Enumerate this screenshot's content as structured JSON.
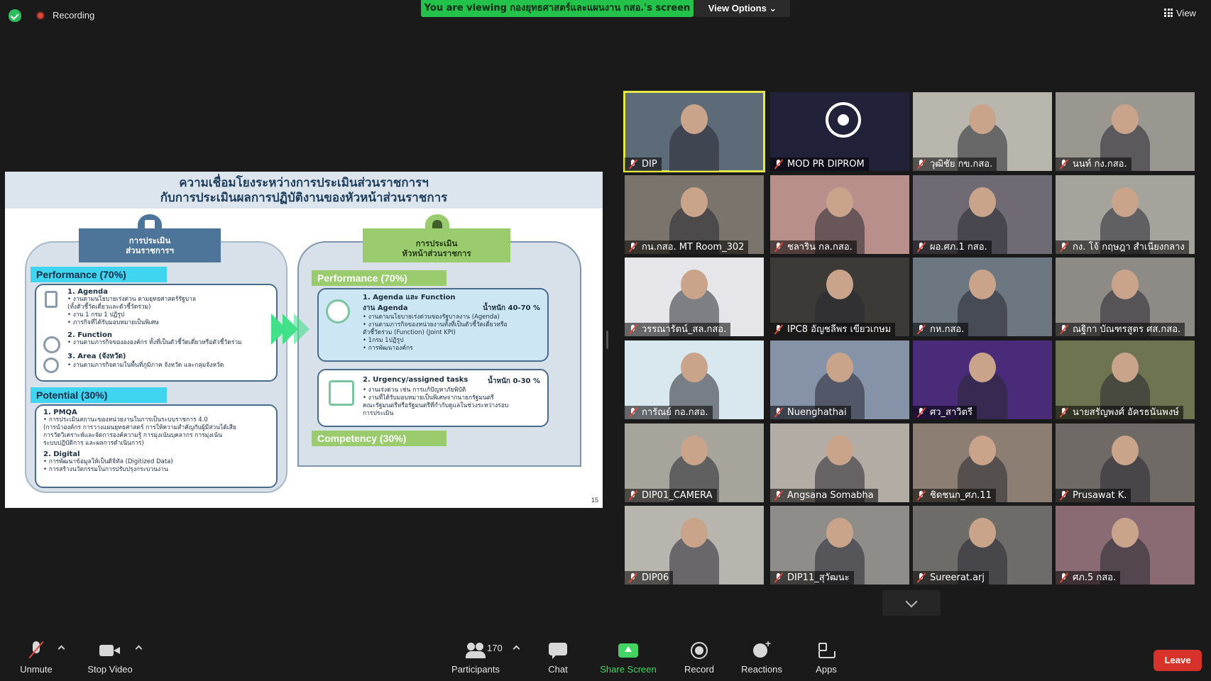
{
  "topbar": {
    "recording_label": "Recording",
    "viewing_banner": "You are viewing กองยุทธศาสตร์และแผนงาน กสอ.'s screen",
    "view_options_label": "View Options ⌄",
    "view_label": "View"
  },
  "slide": {
    "title_line1": "ความเชื่อมโยงระหว่างการประเมินส่วนราชการฯ",
    "title_line2": "กับการประเมินผลการปฏิบัติงานของหัวหน้าส่วนราชการ",
    "left_head_line1": "การประเมิน",
    "left_head_line2": "ส่วนราชการฯ",
    "right_head_line1": "การประเมิน",
    "right_head_line2": "หัวหน้าส่วนราชการ",
    "left_performance": "Performance (70%)",
    "left_potential": "Potential (30%)",
    "right_performance": "Performance (70%)",
    "right_competency": "Competency (30%)",
    "agenda_h": "1. Agenda",
    "agenda_t1": "• งานตามนโยบายเร่งด่วน ตามยุทธศาสตร์รัฐบาล",
    "agenda_t2": "(ทั้งตัวชี้วัดเดี่ยวและตัวชี้วัดร่วม)",
    "agenda_t3": "• งาน 1 กรม 1 ปฏิรูป",
    "agenda_t4": "• ภารกิจที่ได้รับมอบหมายเป็นพิเศษ",
    "function_h": "2. Function",
    "function_t1": "• งานตามภารกิจของององค์กร ทั้งที่เป็นตัวชี้วัดเดี่ยวหรือตัวชี้วัดร่วม",
    "area_h": "3. Area (จังหวัด)",
    "area_t1": "• งานตามภารกิจตามในพื้นที่ภูมิภาค จังหวัด และกลุ่มจังหวัด",
    "pmqa_h": "1. PMQA",
    "pmqa_t1": "• การประเมินสถานะของหน่วยงานในการเป็นระบบราชการ 4.0",
    "pmqa_t2": "(การนำองค์กร การวางแผนยุทธศาสตร์ การให้ความสำคัญกับผู้มีส่วนได้เสีย",
    "pmqa_t3": "การวัดวิเคราะห์และจัดการองค์ความรู้ การมุ่งเน้นบุคลากร การมุ่งเน้น",
    "pmqa_t4": "ระบบปฏิบัติการ และผลการดำเนินการ)",
    "digital_h": "2. Digital",
    "digital_t1": "• การพัฒนาข้อมูลให้เป็นดิจิทัล (Digitized Data)",
    "digital_t2": "• การสร้างนวัตกรรมในการปรับปรุงกระบวนงาน",
    "ra_h": "1. Agenda และ Function",
    "ra_sub": "งาน Agenda",
    "ra_weight": "น้ำหนัก 40-70 %",
    "ra_t1": "• งานตามนโยบายเร่งด่วนของรัฐบาลงาน (Agenda)",
    "ra_t2": "• งานตามภารกิจของหน่วยงานทั้งที่เป็นตัวชี้วัดเดี่ยวหรือ",
    "ra_t3": "ตัวชี้วัดร่วม (Function) (Joint KPI)",
    "ra_t4": "• 1กรม 1ปฏิรูป",
    "ra_t5": "• การพัฒนาองค์กร",
    "rb_h": "2. Urgency/assigned tasks",
    "rb_weight": "น้ำหนัก 0-30 %",
    "rb_t1": "• งานเร่งด่วน เช่น การแก้ปัญหาภัยพิบัติ",
    "rb_t2": "• งานที่ได้รับมอบหมายเป็นพิเศษจากนายกรัฐมนตรี",
    "rb_t3": "คณะรัฐมนตรีหรือรัฐมนตรีที่กำกับดูแลในช่วงระหว่างรอบ",
    "rb_t4": "การประเมิน",
    "page_number": "15"
  },
  "participants_tiles": [
    {
      "name": "DIP",
      "bg": "#5d6b78",
      "active": true
    },
    {
      "name": "MOD PR DIPROM",
      "bg": "#22213a",
      "active": false
    },
    {
      "name": "วุฒิชัย กข.กสอ.",
      "bg": "#b9b6ae",
      "active": false
    },
    {
      "name": "นนท์ กง.กสอ.",
      "bg": "#9a9690",
      "active": false
    },
    {
      "name": "กน.กสอ. MT Room_302",
      "bg": "#7a746c",
      "active": false
    },
    {
      "name": "ชลาริน กล.กสอ.",
      "bg": "#b88f8a",
      "active": false
    },
    {
      "name": "ผอ.ศภ.1 กสอ.",
      "bg": "#6f6a74",
      "active": false
    },
    {
      "name": "กง. โจ้ กฤษฎา สำเนียงกลาง",
      "bg": "#a4a39c",
      "active": false
    },
    {
      "name": "วรรณารัตน์_สล.กสอ.",
      "bg": "#e6e6ea",
      "active": false
    },
    {
      "name": "IPC8 อัญชลีพร เขียวเกษม",
      "bg": "#3c3a36",
      "active": false
    },
    {
      "name": "กห.กสอ.",
      "bg": "#6c7782",
      "active": false
    },
    {
      "name": "ณฐิกา บัณฑรสูตร ศส.กสอ.",
      "bg": "#8e8a86",
      "active": false
    },
    {
      "name": "การัณย์ กอ.กสอ.",
      "bg": "#d9e7ee",
      "active": false
    },
    {
      "name": "Nuenghathai",
      "bg": "#8592a8",
      "active": false
    },
    {
      "name": "ศว_สาวิตรี",
      "bg": "#4a2b7a",
      "active": false
    },
    {
      "name": "นายสรัญพงศ์ อัครธนันพงษ์",
      "bg": "#6f7450",
      "active": false
    },
    {
      "name": "DIP01_CAMERA",
      "bg": "#a7a49c",
      "active": false
    },
    {
      "name": "Angsana Somabha",
      "bg": "#b3aca4",
      "active": false
    },
    {
      "name": "ชิดชนก_ศภ.11",
      "bg": "#8c7e72",
      "active": false
    },
    {
      "name": "Prusawat K.",
      "bg": "#6f6a66",
      "active": false
    },
    {
      "name": "DIP06",
      "bg": "#b8b4ae",
      "active": false
    },
    {
      "name": "DIP11_สุวัฒนะ",
      "bg": "#8f8d8a",
      "active": false
    },
    {
      "name": "Sureerat.arj",
      "bg": "#6e6c68",
      "active": false
    },
    {
      "name": "ศภ.5 กสอ.",
      "bg": "#8a6b74",
      "active": false
    }
  ],
  "toolbar": {
    "unmute": "Unmute",
    "stop_video": "Stop Video",
    "participants": "Participants",
    "participant_count": "170",
    "chat": "Chat",
    "share_screen": "Share Screen",
    "record": "Record",
    "reactions": "Reactions",
    "apps": "Apps",
    "leave": "Leave"
  },
  "colors": {
    "banner_green": "#23c24b",
    "share_green": "#43d464",
    "leave_red": "#d8332a",
    "active_speaker": "#e5e84a"
  }
}
